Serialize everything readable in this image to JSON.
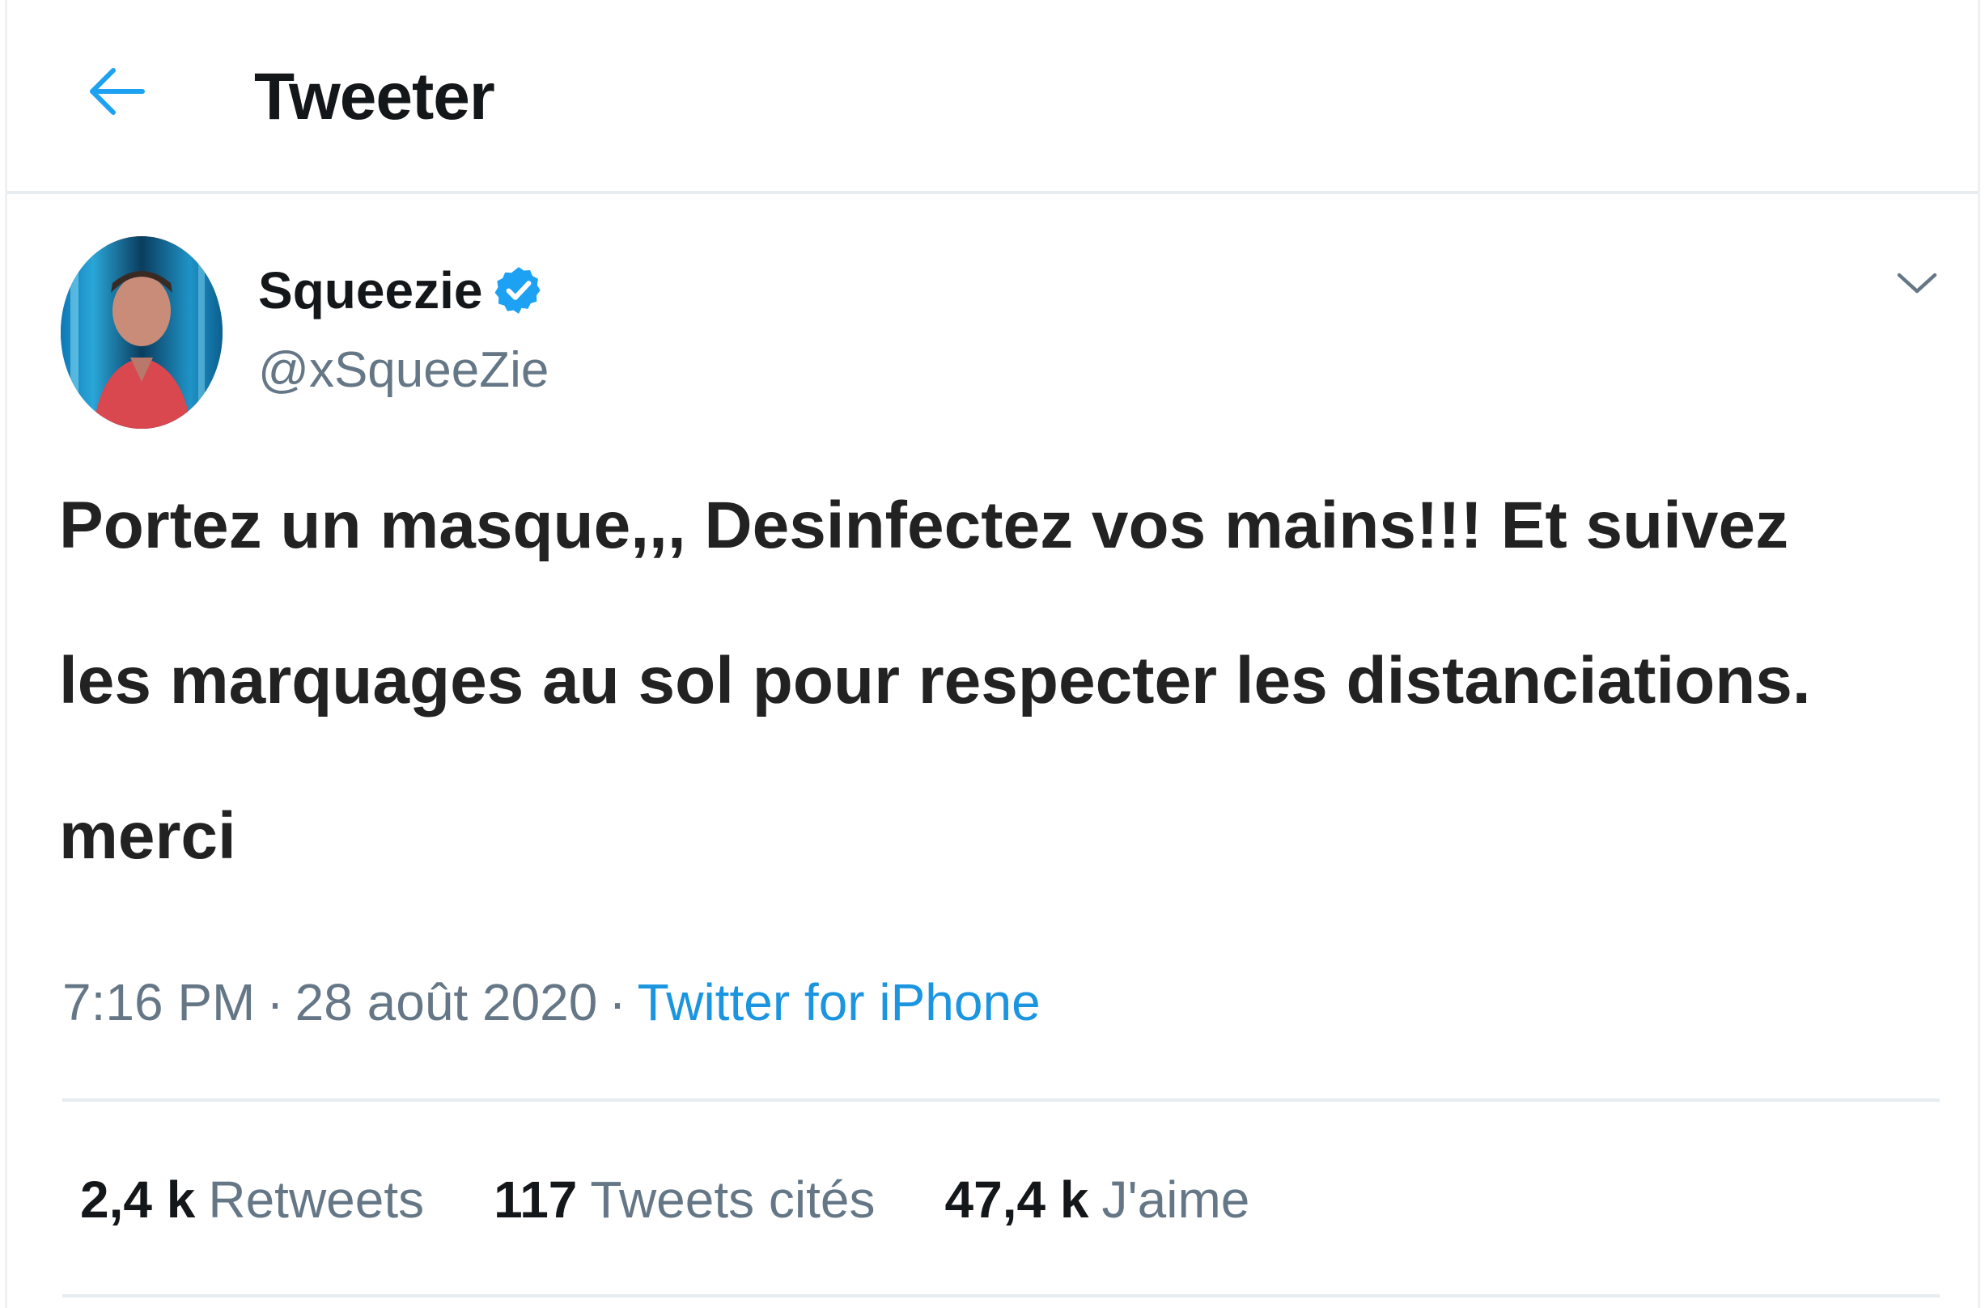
{
  "header": {
    "title": "Tweeter",
    "back_icon": "arrow-left-icon",
    "accent_color": "#1da1f2"
  },
  "author": {
    "name": "Squeezie",
    "handle": "@xSqueeZie",
    "verified_icon": "verified-badge-icon",
    "verified_color": "#1da1f2"
  },
  "tweet": {
    "lines": [
      "Portez un masque,,, Desinfectez vos mains!!! Et suivez",
      "les marquages au sol pour respecter les distanciations.",
      "merci"
    ]
  },
  "meta": {
    "time": "7:16 PM",
    "separator": "·",
    "date": "28 août 2020",
    "source": "Twitter for iPhone",
    "source_color": "#1b95e0"
  },
  "stats": {
    "retweets_count": "2,4 k",
    "retweets_label": "Retweets",
    "quotes_count": "117",
    "quotes_label": "Tweets cités",
    "likes_count": "47,4 k",
    "likes_label": "J'aime"
  },
  "menu": {
    "caret_icon": "chevron-down-icon"
  }
}
